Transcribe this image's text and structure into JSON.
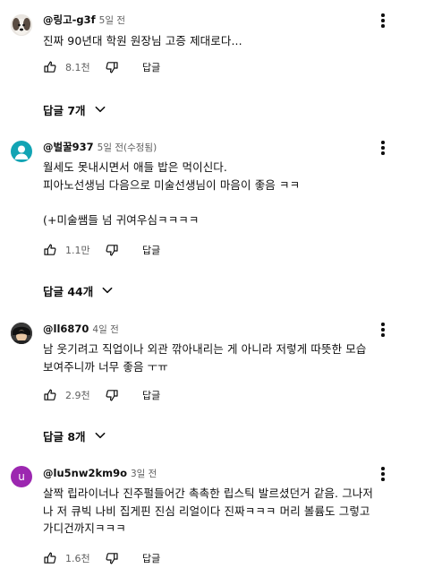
{
  "comments": [
    {
      "handle": "@링고-g3f",
      "time": "5일 전",
      "text": "진짜 90년대 학원 원장님 고증 제대로다...",
      "likes": "8.1천",
      "reply_label": "답글",
      "replies_label": "답글 7개",
      "avatar": {
        "type": "image",
        "color": "#6b5f55"
      }
    },
    {
      "handle": "@벌꿀937",
      "time": "5일 전(수정됨)",
      "text": "월세도 못내시면서 애들 밥은 먹이신다.\n피아노선생님 다음으로 미술선생님이 마음이 좋음 ㅋㅋ\n\n(+미술쌤들 넘 귀여우심ㅋㅋㅋㅋ",
      "likes": "1.1만",
      "reply_label": "답글",
      "replies_label": "답글 44개",
      "avatar": {
        "type": "person",
        "color": "#12a4b4"
      }
    },
    {
      "handle": "@ll6870",
      "time": "4일 전",
      "text": "남 웃기려고 직업이나 외관 깎아내리는 게 아니라 저렇게 따뜻한 모습\n보여주니까 너무 좋음 ㅜㅠ",
      "likes": "2.9천",
      "reply_label": "답글",
      "replies_label": "답글 8개",
      "avatar": {
        "type": "image",
        "color": "#2b2b2b"
      }
    },
    {
      "handle": "@lu5nw2km9o",
      "time": "3일 전",
      "text": "살짝 립라이너나 진주펄들어간 촉촉한 립스틱 발르셨던거 같음. 그나저\n나 저 큐빅 나비 집게핀 진심 리얼이다 진짜ㅋㅋㅋ 머리 볼륨도 그렇고\n가디건까지ㅋㅋㅋ",
      "likes": "1.6천",
      "reply_label": "답글",
      "avatar": {
        "type": "letter",
        "letter": "u",
        "color": "#9c27b0"
      }
    }
  ],
  "icons": {
    "like": "thumb-up-icon",
    "dislike": "thumb-down-icon",
    "more": "kebab-menu-icon",
    "expand": "chevron-down-icon"
  }
}
